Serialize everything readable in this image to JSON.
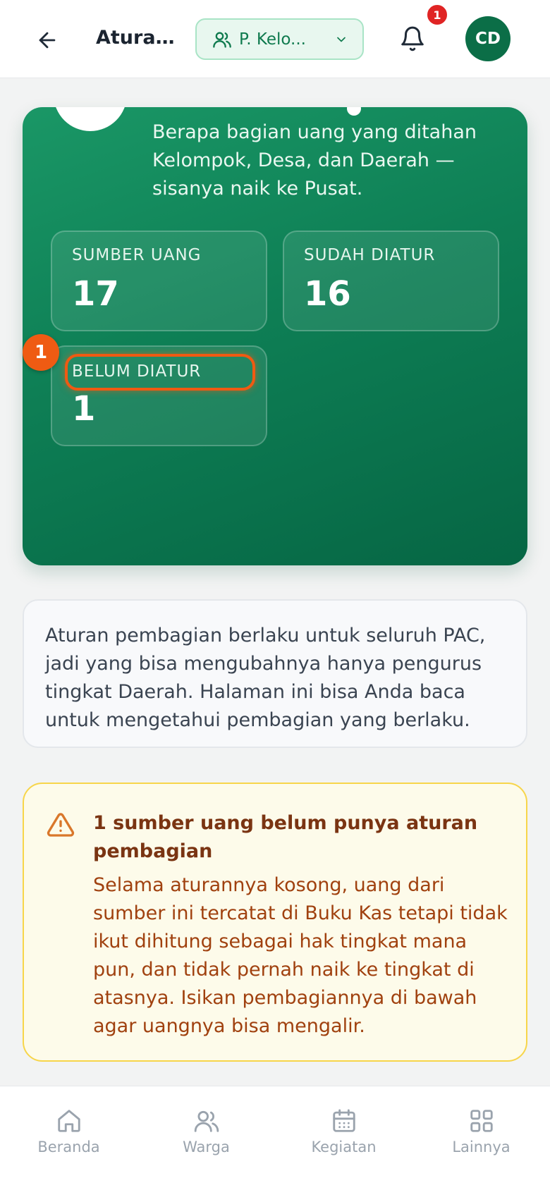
{
  "header": {
    "title": "Aturan ...",
    "group_selector": "P. Kelo...",
    "notification_count": "1",
    "avatar_initials": "CD"
  },
  "hero": {
    "description": "Berapa bagian uang yang ditahan Kelompok, Desa, dan Daerah — sisanya naik ke Pusat.",
    "stats": [
      {
        "label": "SUMBER UANG",
        "value": "17"
      },
      {
        "label": "SUDAH DIATUR",
        "value": "16"
      },
      {
        "label": "BELUM DIATUR",
        "value": "1"
      }
    ],
    "step_badge": "1"
  },
  "info": {
    "text": "Aturan pembagian berlaku untuk seluruh PAC, jadi yang bisa mengubahnya hanya pengurus tingkat Daerah. Halaman ini bisa Anda baca untuk mengetahui pembagian yang berlaku."
  },
  "warning": {
    "title": "1 sumber uang belum punya aturan pembagian",
    "body": "Selama aturannya kosong, uang dari sumber ini tercatat di Buku Kas tetapi tidak ikut dihitung sebagai hak tingkat mana pun, dan tidak pernah naik ke tingkat di atasnya. Isikan pembagiannya di bawah agar uangnya bisa mengalir."
  },
  "bottom_nav": [
    {
      "label": "Beranda",
      "icon": "home-icon"
    },
    {
      "label": "Warga",
      "icon": "users-icon"
    },
    {
      "label": "Kegiatan",
      "icon": "calendar-icon"
    },
    {
      "label": "Lainnya",
      "icon": "grid-icon"
    }
  ],
  "colors": {
    "brand_green": "#0b6e47",
    "highlight_orange": "#ef5b13",
    "warning_text": "#a0410f"
  }
}
